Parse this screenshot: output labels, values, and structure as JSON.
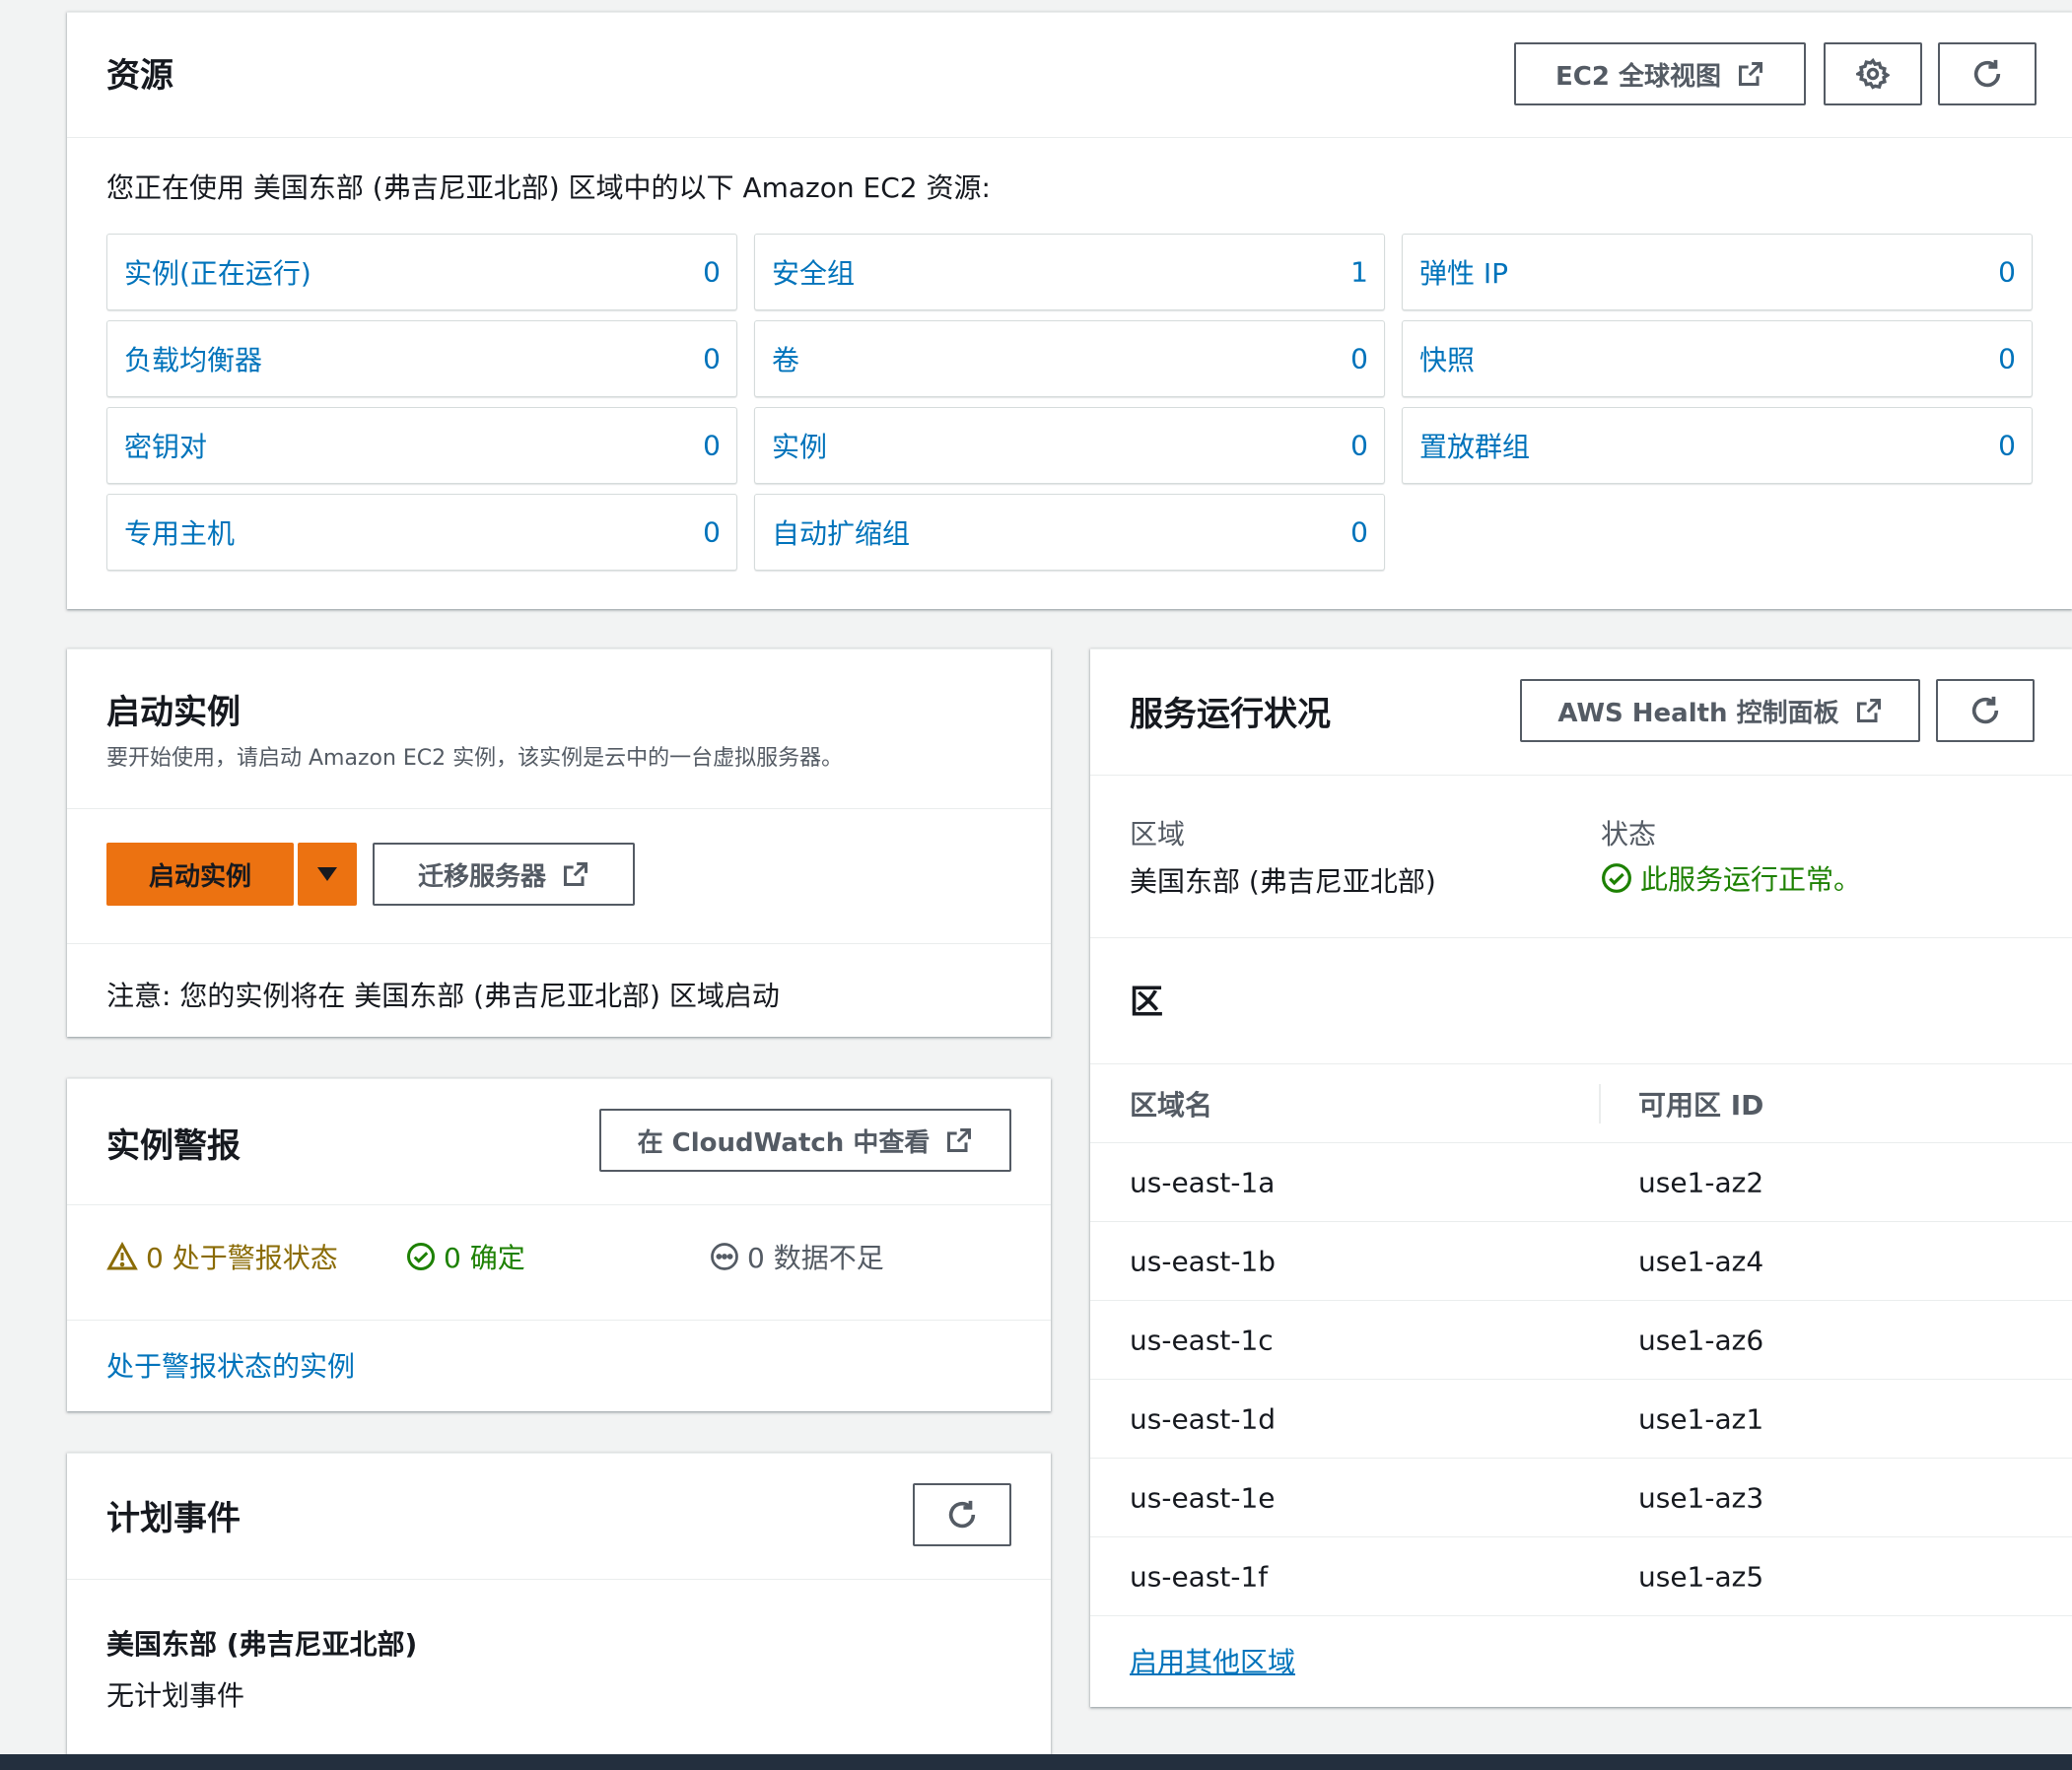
{
  "resources": {
    "title": "资源",
    "global_view_label": "EC2 全球视图",
    "description": "您正在使用 美国东部 (弗吉尼亚北部) 区域中的以下 Amazon EC2 资源:",
    "items": [
      {
        "label": "实例(正在运行)",
        "count": "0"
      },
      {
        "label": "安全组",
        "count": "1"
      },
      {
        "label": "弹性 IP",
        "count": "0"
      },
      {
        "label": "负载均衡器",
        "count": "0"
      },
      {
        "label": "卷",
        "count": "0"
      },
      {
        "label": "快照",
        "count": "0"
      },
      {
        "label": "密钥对",
        "count": "0"
      },
      {
        "label": "实例",
        "count": "0"
      },
      {
        "label": "置放群组",
        "count": "0"
      },
      {
        "label": "专用主机",
        "count": "0"
      },
      {
        "label": "自动扩缩组",
        "count": "0"
      }
    ]
  },
  "launch": {
    "title": "启动实例",
    "subtitle": "要开始使用，请启动 Amazon EC2 实例，该实例是云中的一台虚拟服务器。",
    "launch_button": "启动实例",
    "migrate_button": "迁移服务器",
    "note": "注意: 您的实例将在 美国东部 (弗吉尼亚北部) 区域启动"
  },
  "alarms": {
    "title": "实例警报",
    "cloudwatch_button": "在 CloudWatch 中查看",
    "in_alarm": "0 处于警报状态",
    "ok": "0 确定",
    "insufficient": "0 数据不足",
    "link": "处于警报状态的实例"
  },
  "events": {
    "title": "计划事件",
    "region": "美国东部 (弗吉尼亚北部)",
    "none": "无计划事件"
  },
  "health": {
    "title": "服务运行状况",
    "dashboard_button": "AWS Health 控制面板",
    "region_label": "区域",
    "region_value": "美国东部 (弗吉尼亚北部)",
    "status_label": "状态",
    "status_value": "此服务运行正常。"
  },
  "zones": {
    "title": "区",
    "col_name": "区域名",
    "col_id": "可用区 ID",
    "rows": [
      {
        "name": "us-east-1a",
        "id": "use1-az2"
      },
      {
        "name": "us-east-1b",
        "id": "use1-az4"
      },
      {
        "name": "us-east-1c",
        "id": "use1-az6"
      },
      {
        "name": "us-east-1d",
        "id": "use1-az1"
      },
      {
        "name": "us-east-1e",
        "id": "use1-az3"
      },
      {
        "name": "us-east-1f",
        "id": "use1-az5"
      }
    ],
    "enable_link": "启用其他区域"
  },
  "colors": {
    "link": "#0073bb",
    "primary": "#ec7211",
    "success": "#1d8102",
    "warning": "#8a6b05",
    "footer": "#232f3e"
  }
}
